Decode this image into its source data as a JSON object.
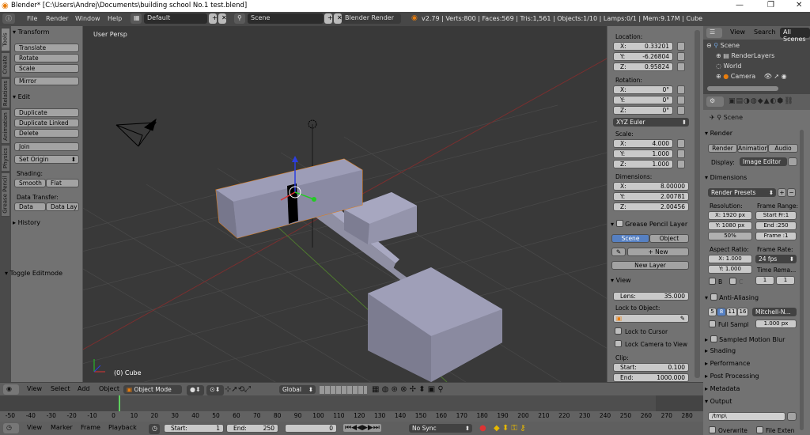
{
  "window": {
    "title": "Blender* [C:\\Users\\Andrej\\Documents\\building school No.1 test.blend]",
    "minimize": "—",
    "maximize": "❐",
    "close": "✕"
  },
  "infobar": {
    "menus": [
      "File",
      "Render",
      "Window",
      "Help"
    ],
    "layout": "Default",
    "scene": "Scene",
    "engine": "Blender Render",
    "stats": "v2.79 | Verts:800 | Faces:569 | Tris:1,561 | Objects:1/10 | Lamps:0/1 | Mem:9.17M | Cube"
  },
  "tool_tabs": [
    "Tools",
    "Create",
    "Relations",
    "Animation",
    "Physics",
    "Grease Pencil"
  ],
  "toolshelf": {
    "transform_header": "Transform",
    "transform_buttons": [
      "Translate",
      "Rotate",
      "Scale"
    ],
    "mirror": "Mirror",
    "edit_header": "Edit",
    "edit_buttons": [
      "Duplicate",
      "Duplicate Linked",
      "Delete"
    ],
    "join": "Join",
    "set_origin": "Set Origin",
    "shading_label": "Shading:",
    "smooth": "Smooth",
    "flat": "Flat",
    "data_transfer_label": "Data Transfer:",
    "data": "Data",
    "data_lay": "Data Lay",
    "history": "History",
    "toggle_editmode": "Toggle Editmode"
  },
  "viewport": {
    "view_name": "User Persp",
    "object_label": "(0) Cube"
  },
  "npanel": {
    "location_label": "Location:",
    "location": [
      {
        "k": "X:",
        "v": "0.33201"
      },
      {
        "k": "Y:",
        "v": "-6.26804"
      },
      {
        "k": "Z:",
        "v": "0.95824"
      }
    ],
    "rotation_label": "Rotation:",
    "rotation": [
      {
        "k": "X:",
        "v": "0°"
      },
      {
        "k": "Y:",
        "v": "0°"
      },
      {
        "k": "Z:",
        "v": "0°"
      }
    ],
    "rotation_mode": "XYZ Euler",
    "scale_label": "Scale:",
    "scale": [
      {
        "k": "X:",
        "v": "4.000"
      },
      {
        "k": "Y:",
        "v": "1.000"
      },
      {
        "k": "Z:",
        "v": "1.000"
      }
    ],
    "dimensions_label": "Dimensions:",
    "dimensions": [
      {
        "k": "X:",
        "v": "8.00000"
      },
      {
        "k": "Y:",
        "v": "2.00781"
      },
      {
        "k": "Z:",
        "v": "2.00456"
      }
    ],
    "grease_pencil_layer": "Grease Pencil Layer",
    "gp_scene": "Scene",
    "gp_object": "Object",
    "gp_new": "New",
    "gp_new_layer": "New Layer",
    "view_header": "View",
    "lens": {
      "k": "Lens:",
      "v": "35.000"
    },
    "lock_to_object": "Lock to Object:",
    "lock_to_cursor": "Lock to Cursor",
    "lock_camera_to_view": "Lock Camera to View",
    "clip_label": "Clip:",
    "clip_start": {
      "k": "Start:",
      "v": "0.100"
    },
    "clip_end": {
      "k": "End:",
      "v": "1000.000"
    }
  },
  "outliner": {
    "view": "View",
    "search": "Search",
    "all_scenes": "All Scenes",
    "items": [
      "Scene",
      "RenderLayers",
      "World",
      "Camera"
    ]
  },
  "properties": {
    "breadcrumb": "Scene",
    "render_header": "Render",
    "render_btn": "Render",
    "animation_btn": "Animation",
    "audio_btn": "Audio",
    "display_label": "Display:",
    "display_value": "Image Editor",
    "dimensions_header": "Dimensions",
    "render_presets": "Render Presets",
    "resolution_label": "Resolution:",
    "res_x": "X: 1920 px",
    "res_y": "Y: 1080 px",
    "res_pct": "50%",
    "frame_range_label": "Frame Range:",
    "start_fr": "Start Fr:1",
    "end": "End :250",
    "frame": "Frame :1",
    "aspect_label": "Aspect Ratio:",
    "asp_x": "X: 1.000",
    "asp_y": "Y: 1.000",
    "frame_rate_label": "Frame Rate:",
    "fps": "24 fps",
    "time_rema": "Time Rema...",
    "tr_1": "1",
    "tr_2": "1",
    "b_label": "B",
    "c_label": "C",
    "aa_header": "Anti-Aliasing",
    "aa_samples": [
      "5",
      "8",
      "11",
      "16"
    ],
    "aa_filter": "Mitchell-N...",
    "full_sample": "Full Sampl",
    "filter_size": "1.000 px",
    "collapsed": [
      "Sampled Motion Blur",
      "Shading",
      "Performance",
      "Post Processing",
      "Metadata"
    ],
    "output_header": "Output",
    "output_path": "/tmp\\",
    "overwrite": "Overwrite",
    "file_exten": "File Exten"
  },
  "view3d_header": {
    "menus": [
      "View",
      "Select",
      "Add",
      "Object"
    ],
    "mode": "Object Mode",
    "pivot": "Global"
  },
  "timeline": {
    "ticks": [
      "-50",
      "-40",
      "-30",
      "-20",
      "-10",
      "0",
      "10",
      "20",
      "30",
      "40",
      "50",
      "60",
      "70",
      "80",
      "90",
      "100",
      "110",
      "120",
      "130",
      "140",
      "150",
      "160",
      "170",
      "180",
      "190",
      "200",
      "210",
      "220",
      "230",
      "240",
      "250",
      "260",
      "270",
      "280"
    ],
    "menus": [
      "View",
      "Marker",
      "Frame",
      "Playback"
    ],
    "start": {
      "k": "Start:",
      "v": "1"
    },
    "end": {
      "k": "End:",
      "v": "250"
    },
    "current": "0",
    "sync": "No Sync"
  }
}
